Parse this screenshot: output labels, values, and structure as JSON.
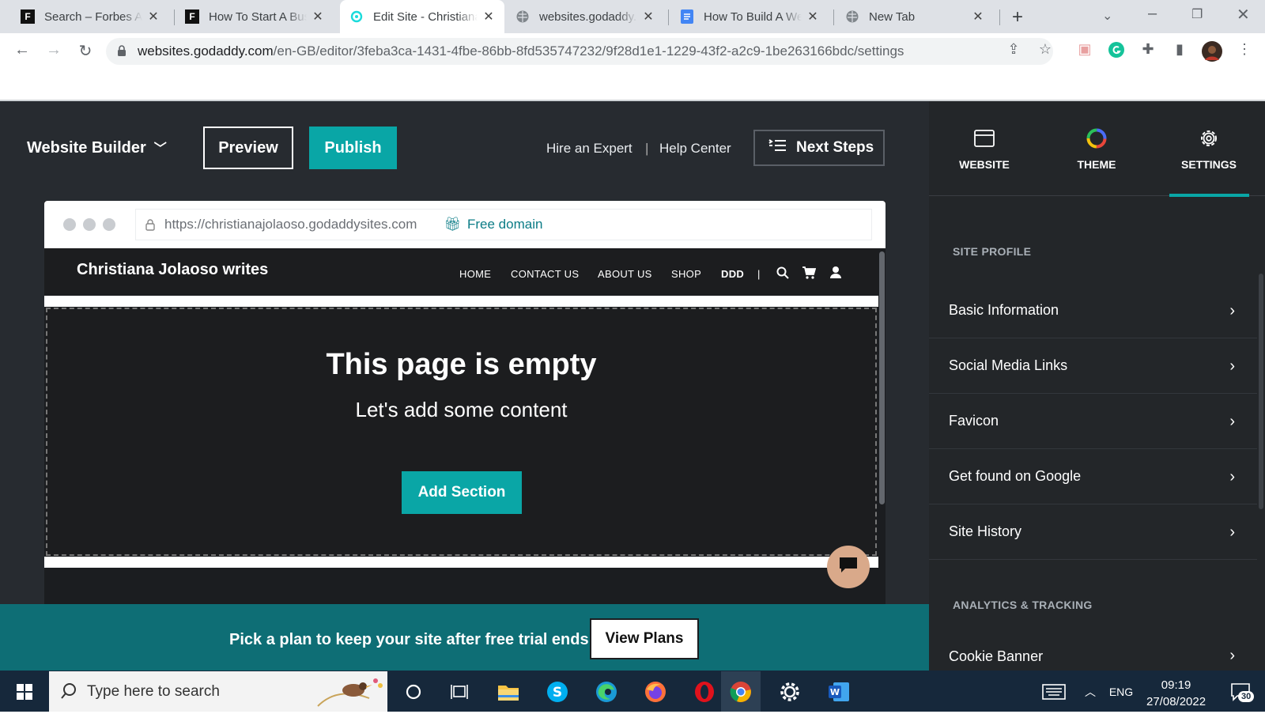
{
  "browser": {
    "tabs": [
      {
        "title": "Search – Forbes Advisor",
        "icon": "forbes-icon"
      },
      {
        "title": "How To Start A Business",
        "icon": "forbes-icon"
      },
      {
        "title": "Edit Site - Christiana Jolaoso writes",
        "icon": "godaddy-icon"
      },
      {
        "title": "websites.godaddy.com",
        "icon": "globe-icon"
      },
      {
        "title": "How To Build A Website",
        "icon": "docs-icon"
      },
      {
        "title": "New Tab",
        "icon": "globe-icon"
      }
    ],
    "url_host": "websites.godaddy.com",
    "url_path": "/en-GB/editor/3feba3ca-1431-4fbe-86bb-8fd535747232/9f28d1e1-1229-43f2-a2c9-1be263166bdc/settings"
  },
  "editor": {
    "brand": "Website Builder",
    "preview": "Preview",
    "publish": "Publish",
    "hire": "Hire an Expert",
    "divider": "|",
    "help": "Help Center",
    "next_steps": "Next Steps"
  },
  "preview": {
    "site_url": "https://christianajolaoso.godaddysites.com",
    "free_domain": "Free domain",
    "site_title": "Christiana Jolaoso writes",
    "nav": [
      "HOME",
      "CONTACT US",
      "ABOUT US",
      "SHOP",
      "DDD"
    ],
    "nav_divider": "|",
    "empty_title": "This page is empty",
    "empty_sub": "Let's add some content",
    "add_section": "Add Section"
  },
  "trial": {
    "text": "Pick a plan to keep your site after free trial ends",
    "button": "View Plans"
  },
  "panel": {
    "tabs": [
      "WEBSITE",
      "THEME",
      "SETTINGS"
    ],
    "active_tab": "SETTINGS",
    "section1": "SITE PROFILE",
    "items": [
      "Basic Information",
      "Social Media Links",
      "Favicon",
      "Get found on Google",
      "Site History"
    ],
    "section2": "ANALYTICS & TRACKING",
    "items2": [
      "Cookie Banner"
    ]
  },
  "taskbar": {
    "search_placeholder": "Type here to search",
    "lang": "ENG",
    "time": "09:19",
    "date": "27/08/2022",
    "notifications": "30"
  },
  "colors": {
    "accent": "#09a6a6",
    "editor_bg": "#272b30",
    "banner": "#0e6e75"
  }
}
